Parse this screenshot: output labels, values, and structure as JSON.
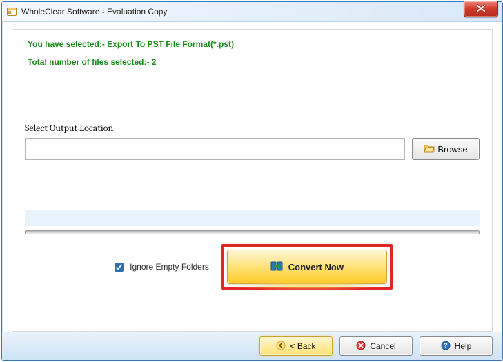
{
  "window": {
    "title": "WholeClear Software - Evaluation Copy"
  },
  "info": {
    "export_line": "You have selected:- Export To PST File Format(*.pst)",
    "count_line": "Total number of files selected:- 2"
  },
  "output": {
    "label": "Select Output Location",
    "path_value": "",
    "path_placeholder": ""
  },
  "buttons": {
    "browse": "Browse",
    "convert": "Convert Now",
    "back": "< Back",
    "cancel": "Cancel",
    "help": "Help"
  },
  "options": {
    "ignore_label": "Ignore Empty Folders",
    "ignore_checked": true
  },
  "icons": {
    "app": "app-icon",
    "close": "close-icon",
    "folder": "folder-open-icon",
    "convert": "convert-icon",
    "back": "arrow-left-circle-icon",
    "cancel": "cancel-circle-icon",
    "help": "help-circle-icon"
  },
  "colors": {
    "accent_green": "#1a8a1a",
    "highlight_red": "#e22626",
    "convert_yellow": "#ffdf6e"
  }
}
